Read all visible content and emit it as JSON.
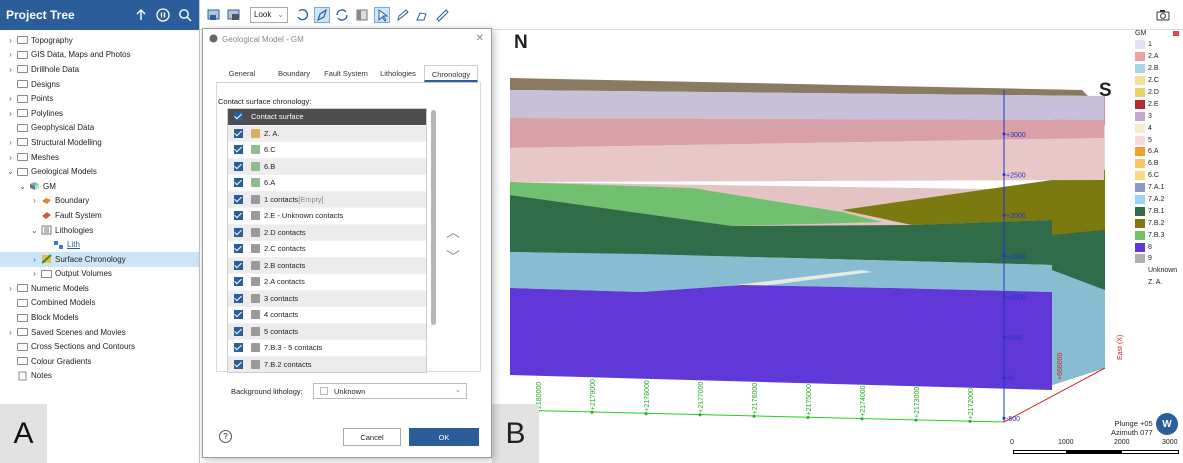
{
  "tree": {
    "title": "Project Tree",
    "items": [
      {
        "label": "Topography",
        "chev": "›",
        "indent": 0,
        "icon": "folder"
      },
      {
        "label": "GIS Data, Maps and Photos",
        "chev": "›",
        "indent": 0,
        "icon": "folder"
      },
      {
        "label": "Drillhole Data",
        "chev": "›",
        "indent": 0,
        "icon": "folder"
      },
      {
        "label": "Designs",
        "chev": "",
        "indent": 0,
        "icon": "folder"
      },
      {
        "label": "Points",
        "chev": "›",
        "indent": 0,
        "icon": "folder"
      },
      {
        "label": "Polylines",
        "chev": "›",
        "indent": 0,
        "icon": "folder"
      },
      {
        "label": "Geophysical Data",
        "chev": "",
        "indent": 0,
        "icon": "folder"
      },
      {
        "label": "Structural Modelling",
        "chev": "›",
        "indent": 0,
        "icon": "folder"
      },
      {
        "label": "Meshes",
        "chev": "›",
        "indent": 0,
        "icon": "folder"
      },
      {
        "label": "Geological Models",
        "chev": "⌄",
        "indent": 0,
        "icon": "folder"
      },
      {
        "label": "GM",
        "chev": "⌄",
        "indent": 1,
        "icon": "gm"
      },
      {
        "label": "Boundary",
        "chev": "›",
        "indent": 2,
        "icon": "boundary"
      },
      {
        "label": "Fault System",
        "chev": "",
        "indent": 2,
        "icon": "fault"
      },
      {
        "label": "Lithologies",
        "chev": "⌄",
        "indent": 2,
        "icon": "list"
      },
      {
        "label": "Lith",
        "chev": "",
        "indent": 3,
        "icon": "lith",
        "link": true
      },
      {
        "label": "Surface Chronology",
        "chev": "›",
        "indent": 2,
        "icon": "chron",
        "selected": true
      },
      {
        "label": "Output Volumes",
        "chev": "›",
        "indent": 2,
        "icon": "folder"
      },
      {
        "label": "Numeric Models",
        "chev": "›",
        "indent": 0,
        "icon": "folder"
      },
      {
        "label": "Combined Models",
        "chev": "",
        "indent": 0,
        "icon": "folder"
      },
      {
        "label": "Block Models",
        "chev": "",
        "indent": 0,
        "icon": "folder"
      },
      {
        "label": "Saved Scenes and Movies",
        "chev": "›",
        "indent": 0,
        "icon": "folder"
      },
      {
        "label": "Cross Sections and Contours",
        "chev": "",
        "indent": 0,
        "icon": "folder"
      },
      {
        "label": "Colour Gradients",
        "chev": "",
        "indent": 0,
        "icon": "folder"
      },
      {
        "label": "Notes",
        "chev": "",
        "indent": 0,
        "icon": "note"
      }
    ]
  },
  "panel_letters": {
    "a": "A",
    "b": "B"
  },
  "toolbar": {
    "look_label": "Look"
  },
  "dialog": {
    "title": "Geological Model - GM",
    "tabs": [
      "General",
      "Boundary",
      "Fault System",
      "Lithologies",
      "Chronology"
    ],
    "active_tab": 4,
    "chronology_label": "Contact surface chronology:",
    "list_header": "Contact surface",
    "rows": [
      {
        "label": "Z. A.",
        "color": "#d8b25a"
      },
      {
        "label": "6.C",
        "color": "#8fbc8f"
      },
      {
        "label": "6.B",
        "color": "#8fbc8f"
      },
      {
        "label": "6.A",
        "color": "#8fbc8f"
      },
      {
        "label": "1 contacts",
        "suffix": " [Empty]",
        "color": "#9a9a9a"
      },
      {
        "label": "2.E - Unknown contacts",
        "color": "#9a9a9a"
      },
      {
        "label": "2.D contacts",
        "color": "#9a9a9a"
      },
      {
        "label": "2.C contacts",
        "color": "#9a9a9a"
      },
      {
        "label": "2.B contacts",
        "color": "#9a9a9a"
      },
      {
        "label": "2.A contacts",
        "color": "#9a9a9a"
      },
      {
        "label": "3 contacts",
        "color": "#9a9a9a"
      },
      {
        "label": "4 contacts",
        "color": "#9a9a9a"
      },
      {
        "label": "5 contacts",
        "color": "#9a9a9a"
      },
      {
        "label": "7.B.3 - 5 contacts",
        "color": "#9a9a9a"
      },
      {
        "label": "7.B.2 contacts",
        "color": "#9a9a9a"
      }
    ],
    "background_label": "Background lithology:",
    "background_value": "Unknown",
    "cancel_label": "Cancel",
    "ok_label": "OK",
    "help_label": "?"
  },
  "viewport": {
    "north_label": "N",
    "south_label": "S",
    "elevation_ticks": [
      "+3000",
      "+2500",
      "+2000",
      "+1500",
      "+1000",
      "+500",
      "+0",
      "-500"
    ],
    "north_ticks": [
      "2180000",
      "+2179000",
      "+2178000",
      "+2177000",
      "+2176000",
      "+2175000",
      "+2174000",
      "+2173000",
      "+2172000"
    ],
    "east_label": "East (X)",
    "east_tick": "+666000",
    "plunge": "Plunge +05",
    "azimuth": "Azimuth 077",
    "scale_labels": [
      "0",
      "1000",
      "2000",
      "3000"
    ]
  },
  "legend": {
    "title": "GM",
    "items": [
      {
        "label": "1",
        "color": "#e6e0f0"
      },
      {
        "label": "2.A",
        "color": "#f0a0a0"
      },
      {
        "label": "2.B",
        "color": "#a8d4e4"
      },
      {
        "label": "2.C",
        "color": "#f3e19a"
      },
      {
        "label": "2.D",
        "color": "#ecd070"
      },
      {
        "label": "2.E",
        "color": "#b03030"
      },
      {
        "label": "3",
        "color": "#c2a8d0"
      },
      {
        "label": "4",
        "color": "#f6ecd0"
      },
      {
        "label": "5",
        "color": "#f8d8d8"
      },
      {
        "label": "6.A",
        "color": "#f0a030"
      },
      {
        "label": "6.B",
        "color": "#f8c860"
      },
      {
        "label": "6.C",
        "color": "#f8d880"
      },
      {
        "label": "7.A.1",
        "color": "#9098c8"
      },
      {
        "label": "7.A.2",
        "color": "#9ad4f0"
      },
      {
        "label": "7.B.1",
        "color": "#306b4a"
      },
      {
        "label": "7.B.2",
        "color": "#7a7a10"
      },
      {
        "label": "7.B.3",
        "color": "#70c070"
      },
      {
        "label": "8",
        "color": "#6038d8"
      },
      {
        "label": "9",
        "color": "#b0b0b0"
      },
      {
        "label": "Unknown",
        "color": ""
      },
      {
        "label": "Z. A.",
        "color": ""
      }
    ]
  }
}
